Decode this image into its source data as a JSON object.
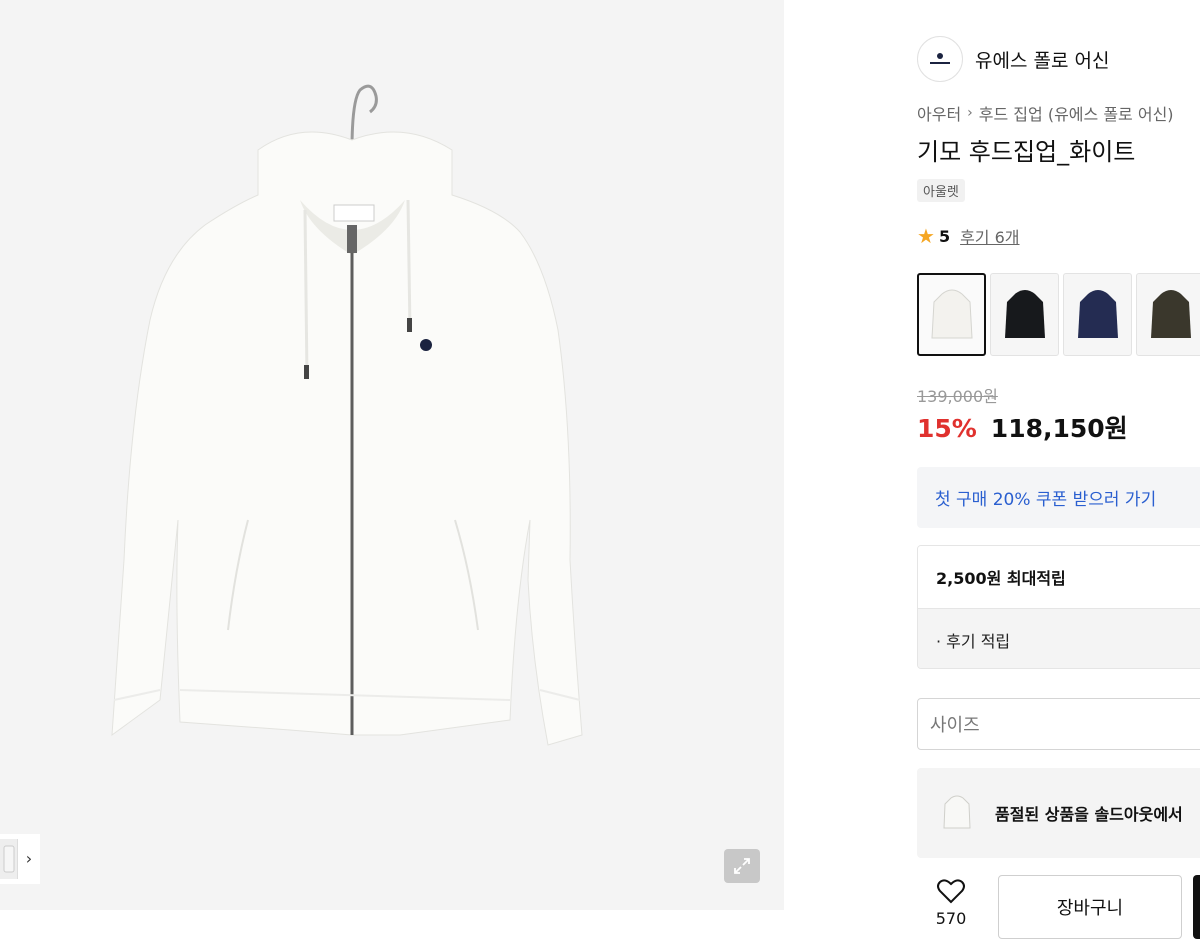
{
  "brand": {
    "name": "유에스 폴로 어신"
  },
  "breadcrumb": {
    "category": "아우터",
    "sub": "후드 집업 (유에스 폴로 어신)"
  },
  "product": {
    "title": "기모 후드집업_화이트",
    "tag": "아울렛",
    "rating": "5",
    "reviews_label": "후기 6개",
    "original_price": "139,000원",
    "discount": "15%",
    "sale_price": "118,150원"
  },
  "swatches": [
    {
      "name": "white",
      "color": "#f3f2ee"
    },
    {
      "name": "black",
      "color": "#17191c"
    },
    {
      "name": "navy",
      "color": "#242c52"
    },
    {
      "name": "olive",
      "color": "#3a372c"
    }
  ],
  "coupon": {
    "label": "첫 구매 20% 쿠폰 받으러 가기"
  },
  "points": {
    "max_label": "2,500원 최대적립",
    "review_label": "· 후기 적립"
  },
  "size": {
    "placeholder": "사이즈"
  },
  "soldout": {
    "label": "품절된 상품을 솔드아웃에서"
  },
  "actions": {
    "like_count": "570",
    "cart_label": "장바구니"
  },
  "colors": {
    "discount": "#e0312e",
    "coupon_text": "#2a5fd0",
    "star": "#f5a623"
  }
}
